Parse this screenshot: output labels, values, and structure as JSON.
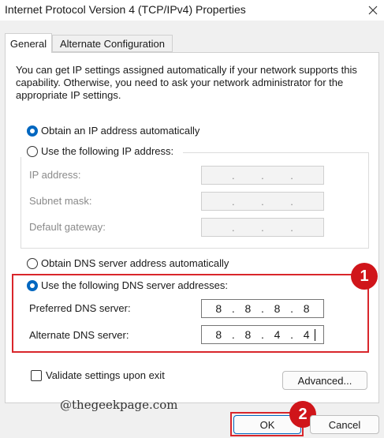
{
  "window": {
    "title": "Internet Protocol Version 4 (TCP/IPv4) Properties"
  },
  "tabs": [
    {
      "label": "General"
    },
    {
      "label": "Alternate Configuration"
    }
  ],
  "description": "You can get IP settings assigned automatically if your network supports this capability. Otherwise, you need to ask your network administrator for the appropriate IP settings.",
  "ip": {
    "auto_label": "Obtain an IP address automatically",
    "manual_label": "Use the following IP address:",
    "fields": [
      {
        "label": "IP address:"
      },
      {
        "label": "Subnet mask:"
      },
      {
        "label": "Default gateway:"
      }
    ]
  },
  "dns": {
    "auto_label": "Obtain DNS server address automatically",
    "manual_label": "Use the following DNS server addresses:",
    "preferred": {
      "label": "Preferred DNS server:",
      "octets": [
        "8",
        "8",
        "8",
        "8"
      ]
    },
    "alternate": {
      "label": "Alternate DNS server:",
      "octets": [
        "8",
        "8",
        "4",
        "4"
      ]
    }
  },
  "validate_label": "Validate settings upon exit",
  "advanced_label": "Advanced...",
  "ok_label": "OK",
  "cancel_label": "Cancel",
  "watermark": "@thegeekpage.com",
  "badges": [
    "1",
    "2"
  ],
  "colors": {
    "accent": "#0067c0",
    "highlight": "#d9262b"
  }
}
